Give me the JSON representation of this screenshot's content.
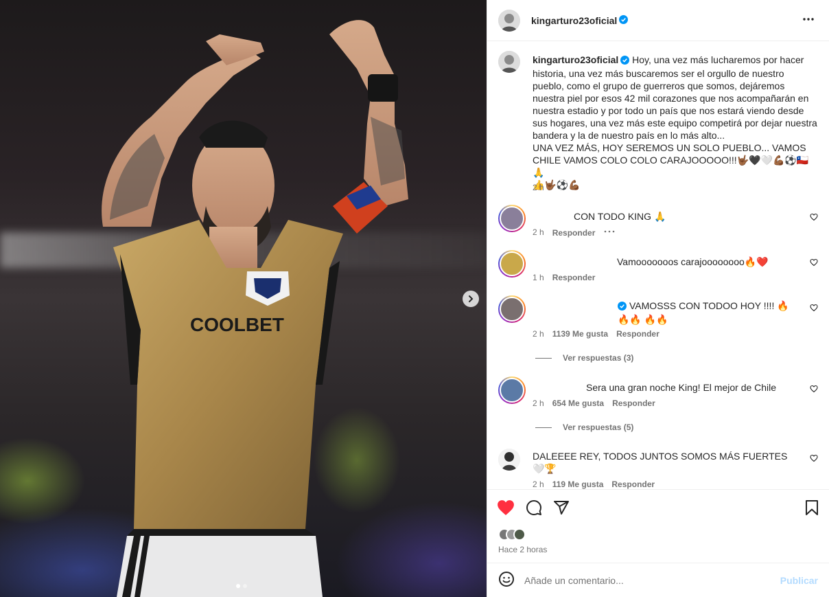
{
  "post": {
    "username": "kingarturo23oficial",
    "caption": "Hoy, una vez más lucharemos por hacer historia, una vez más buscaremos ser el orgullo de nuestro pueblo, como el grupo de guerreros que somos, dejáremos nuestra piel por esos 42 mil corazones que nos acompañarán en nuestra estadio y por todo un país que nos estará viendo desde sus hogares, una vez más este equipo competirá por dejar nuestra bandera y la de nuestro país en lo más alto...\nUNA VEZ MÁS, HOY SEREMOS UN SOLO PUEBLO... VAMOS CHILE VAMOS COLO COLO CARAJOOOOO!!!🤟🏾🖤🤍💪🏾⚽🇨🇱🙏\n👍🤟🏾⚽💪🏾",
    "caption_time": "2 h",
    "jersey_text": "COOLBET",
    "carousel_count": 2
  },
  "comments": [
    {
      "text": "CON TODO KING 🙏",
      "time": "2 h",
      "likes": "",
      "reply_label": "Responder",
      "has_more": true,
      "avatar_color": "#8a7f9a"
    },
    {
      "text": "Vamooooooos carajoooooooo🔥❤️",
      "time": "1 h",
      "likes": "",
      "reply_label": "Responder",
      "avatar_color": "#c9a84a"
    },
    {
      "text": "VAMOSSS CON TODOO HOY !!!! 🔥🔥🔥 🔥🔥",
      "time": "2 h",
      "likes": "1139 Me gusta",
      "reply_label": "Responder",
      "verified": true,
      "avatar_color": "#7a6f6f",
      "replies": "Ver respuestas (3)"
    },
    {
      "text": "Sera una gran noche King! El mejor de Chile",
      "time": "2 h",
      "likes": "654 Me gusta",
      "reply_label": "Responder",
      "avatar_color": "#5b7aa6",
      "replies": "Ver respuestas (5)"
    },
    {
      "text": "DALEEEE REY, TODOS JUNTOS SOMOS MÁS FUERTES 🤍🏆",
      "time": "2 h",
      "likes": "119 Me gusta",
      "reply_label": "Responder",
      "avatar_color": "#3a3a3a"
    }
  ],
  "footer": {
    "time_ago": "Hace 2 horas",
    "comment_placeholder": "Añade un comentario...",
    "publish_label": "Publicar"
  },
  "colors": {
    "like_red": "#ff3040",
    "verified_blue": "#0095f6",
    "jersey_gold": "#a8864a"
  }
}
